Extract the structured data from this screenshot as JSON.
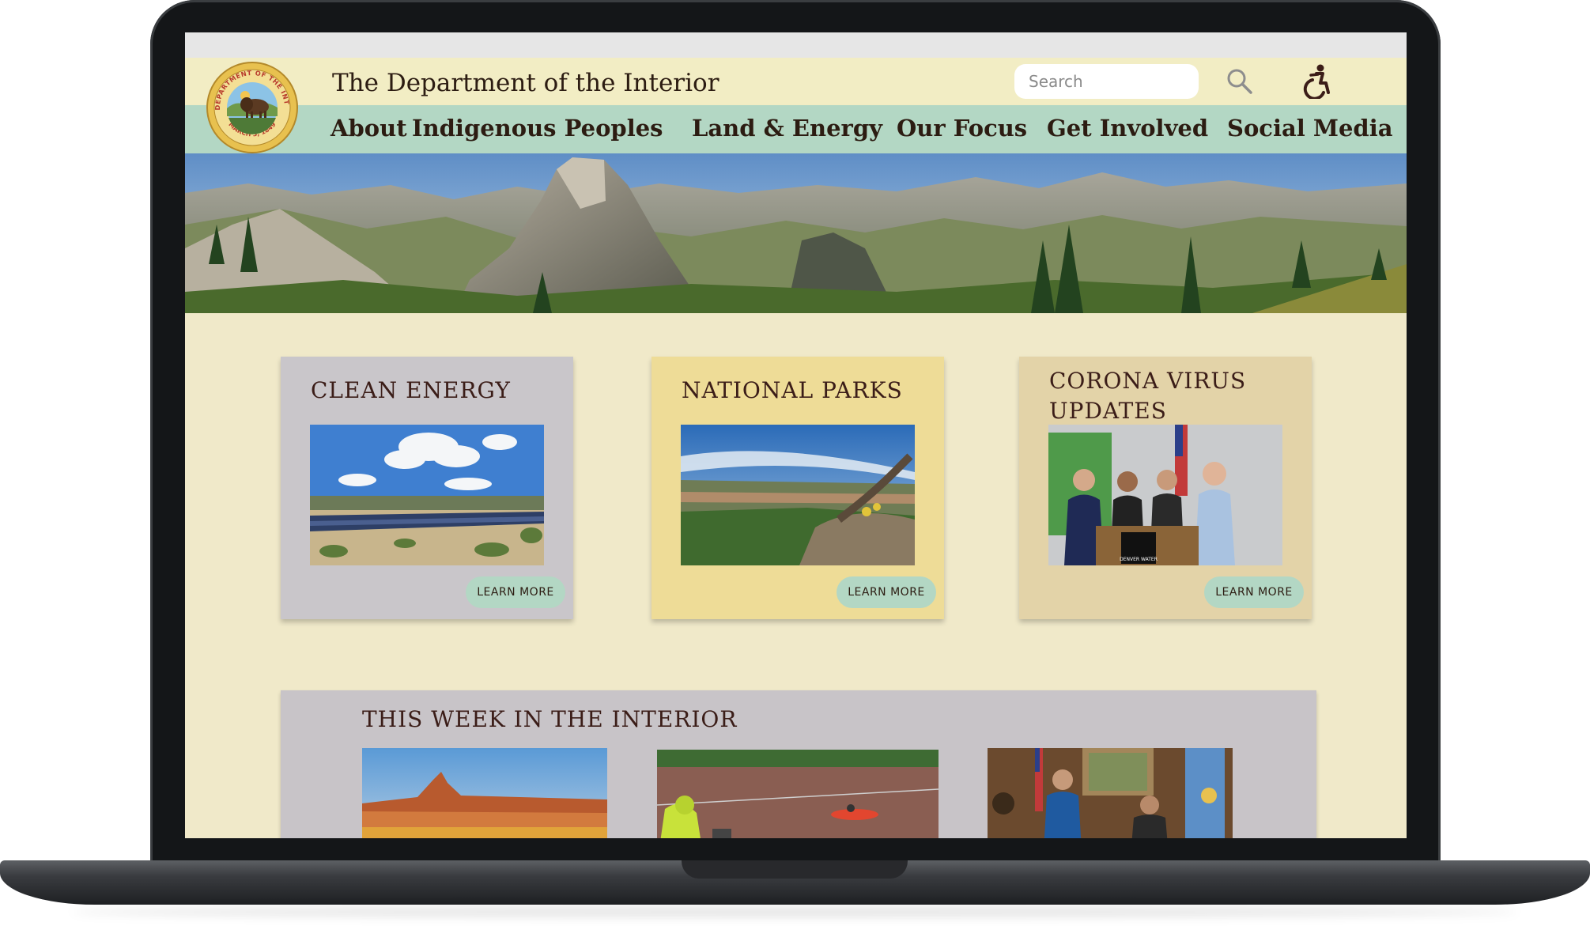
{
  "site": {
    "title": "The Department of the Interior",
    "seal_text_top": "U.S. DEPARTMENT OF THE INTERIOR",
    "seal_text_bottom": "MARCH 3, 1849"
  },
  "search": {
    "placeholder": "Search"
  },
  "icons": {
    "search": "search-icon",
    "accessibility": "accessibility-icon"
  },
  "nav": {
    "items": [
      {
        "label": "About"
      },
      {
        "label": "Indigenous Peoples"
      },
      {
        "label": "Land & Energy"
      },
      {
        "label": "Our Focus"
      },
      {
        "label": "Get Involved"
      },
      {
        "label": "Social Media"
      }
    ]
  },
  "cards": [
    {
      "title": "CLEAN ENERGY",
      "button": "LEARN  MORE",
      "color": "#c9c6ca"
    },
    {
      "title": "NATIONAL PARKS",
      "button": "LEARN  MORE",
      "color": "#eedc97"
    },
    {
      "title": "CORONA VIRUS UPDATES",
      "button": "LEARN  MORE",
      "color": "#e3d3a8",
      "sign_text": "DENVER WATER"
    }
  ],
  "week": {
    "title": "THIS WEEK IN THE INTERIOR"
  },
  "colors": {
    "page_bg": "#f0e9c9",
    "topbar": "#f2edc4",
    "nav": "#b3d7c4",
    "text": "#2c1c12",
    "button": "#b3d7c4"
  }
}
